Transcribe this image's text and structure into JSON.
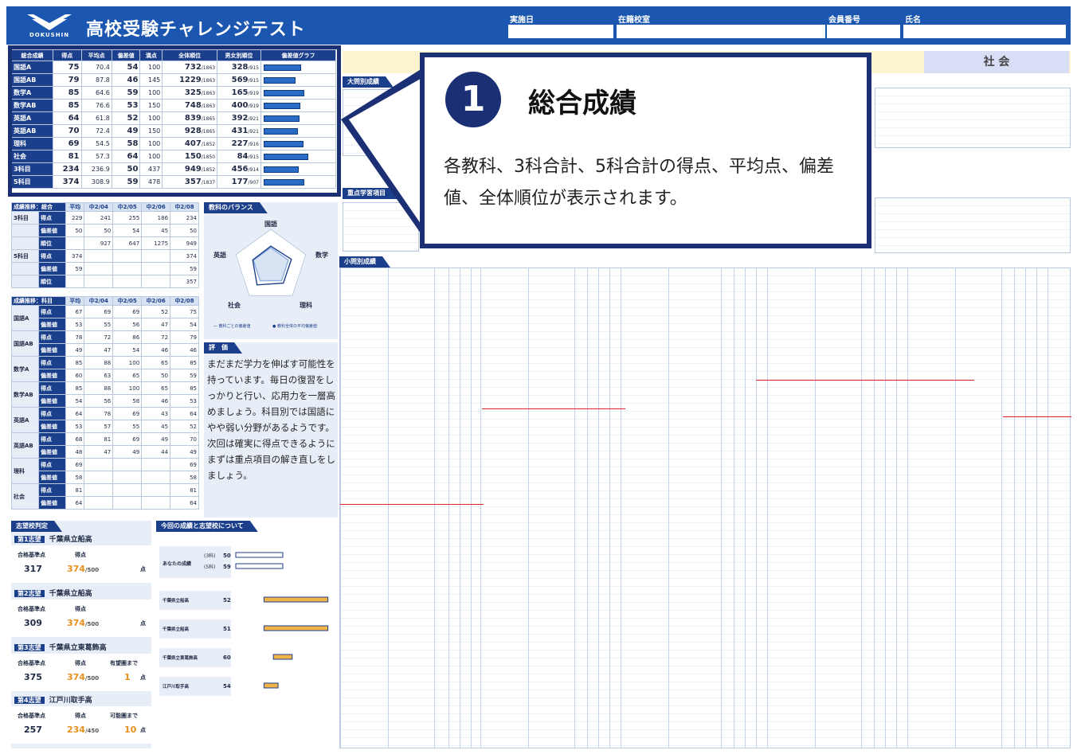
{
  "header": {
    "logo_text": "DOKUSHIN",
    "title": "高校受験チャレンジテスト",
    "fields": [
      "実施日",
      "在籍校室",
      "会員番号",
      "氏名"
    ]
  },
  "summary": {
    "columns": [
      "総合成績",
      "得点",
      "平均点",
      "偏差値",
      "満点",
      "全体順位",
      "男女別順位",
      "偏差値グラフ"
    ],
    "rows": [
      {
        "name": "国語A",
        "score": "75",
        "avg": "70.4",
        "dev": "54",
        "full": "100",
        "rank": "732",
        "rank_total": "/1863",
        "grank": "328",
        "grank_total": "/915",
        "level": 0.54
      },
      {
        "name": "国語AB",
        "score": "79",
        "avg": "87.8",
        "dev": "46",
        "full": "145",
        "rank": "1229",
        "rank_total": "/1863",
        "grank": "569",
        "grank_total": "/915",
        "level": 0.46
      },
      {
        "name": "数学A",
        "score": "85",
        "avg": "64.6",
        "dev": "59",
        "full": "100",
        "rank": "325",
        "rank_total": "/1863",
        "grank": "165",
        "grank_total": "/919",
        "level": 0.59
      },
      {
        "name": "数学AB",
        "score": "85",
        "avg": "76.6",
        "dev": "53",
        "full": "150",
        "rank": "748",
        "rank_total": "/1863",
        "grank": "400",
        "grank_total": "/919",
        "level": 0.53
      },
      {
        "name": "英語A",
        "score": "64",
        "avg": "61.8",
        "dev": "52",
        "full": "100",
        "rank": "839",
        "rank_total": "/1865",
        "grank": "392",
        "grank_total": "/921",
        "level": 0.52
      },
      {
        "name": "英語AB",
        "score": "70",
        "avg": "72.4",
        "dev": "49",
        "full": "150",
        "rank": "928",
        "rank_total": "/1865",
        "grank": "431",
        "grank_total": "/921",
        "level": 0.49
      },
      {
        "name": "理科",
        "score": "69",
        "avg": "54.5",
        "dev": "58",
        "full": "100",
        "rank": "407",
        "rank_total": "/1852",
        "grank": "227",
        "grank_total": "/916",
        "level": 0.58
      },
      {
        "name": "社会",
        "score": "81",
        "avg": "57.3",
        "dev": "64",
        "full": "100",
        "rank": "150",
        "rank_total": "/1850",
        "grank": "84",
        "grank_total": "/915",
        "level": 0.64
      },
      {
        "name": "3科目",
        "score": "234",
        "avg": "236.9",
        "dev": "50",
        "full": "437",
        "rank": "949",
        "rank_total": "/1852",
        "grank": "456",
        "grank_total": "/914",
        "level": 0.5
      },
      {
        "name": "5科目",
        "score": "374",
        "avg": "308.9",
        "dev": "59",
        "full": "478",
        "rank": "357",
        "rank_total": "/1837",
        "grank": "177",
        "grank_total": "/907",
        "level": 0.59
      }
    ]
  },
  "callout": {
    "number": "1",
    "title": "総合成績",
    "body": "各教科、3科合計、5科合計の得点、平均点、偏差値、全体順位が表示されます。"
  },
  "right_top": {
    "subject_social": "社 会"
  },
  "trend_total": {
    "head": "成績推移：総合",
    "cols": [
      "平均",
      "中2/04",
      "中2/05",
      "中2/06",
      "中2/08"
    ],
    "rows": [
      {
        "g": "3科目",
        "k": "得点",
        "v": [
          "229",
          "241",
          "255",
          "186",
          "234"
        ]
      },
      {
        "g": "",
        "k": "偏差値",
        "v": [
          "50",
          "50",
          "54",
          "45",
          "50"
        ]
      },
      {
        "g": "",
        "k": "順位",
        "v": [
          "",
          "927",
          "647",
          "1275",
          "949"
        ]
      },
      {
        "g": "5科目",
        "k": "得点",
        "v": [
          "374",
          "",
          "",
          "",
          "374"
        ]
      },
      {
        "g": "",
        "k": "偏差値",
        "v": [
          "59",
          "",
          "",
          "",
          "59"
        ]
      },
      {
        "g": "",
        "k": "順位",
        "v": [
          "",
          "",
          "",
          "",
          "357"
        ]
      }
    ]
  },
  "trend_subject": {
    "head": "成績推移：科目",
    "cols": [
      "平均",
      "中2/04",
      "中2/05",
      "中2/06",
      "中2/08"
    ],
    "rows": [
      {
        "g": "国語A",
        "v1": [
          "67",
          "69",
          "69",
          "52",
          "75"
        ],
        "v2": [
          "53",
          "55",
          "56",
          "47",
          "54"
        ]
      },
      {
        "g": "国語AB",
        "v1": [
          "78",
          "72",
          "86",
          "72",
          "79"
        ],
        "v2": [
          "49",
          "47",
          "54",
          "46",
          "46"
        ]
      },
      {
        "g": "数学A",
        "v1": [
          "85",
          "88",
          "100",
          "65",
          "85"
        ],
        "v2": [
          "60",
          "63",
          "65",
          "50",
          "59"
        ]
      },
      {
        "g": "数学AB",
        "v1": [
          "85",
          "88",
          "100",
          "65",
          "85"
        ],
        "v2": [
          "54",
          "56",
          "58",
          "46",
          "53"
        ]
      },
      {
        "g": "英語A",
        "v1": [
          "64",
          "78",
          "69",
          "43",
          "64"
        ],
        "v2": [
          "53",
          "57",
          "55",
          "45",
          "52"
        ]
      },
      {
        "g": "英語AB",
        "v1": [
          "68",
          "81",
          "69",
          "49",
          "70"
        ],
        "v2": [
          "48",
          "47",
          "49",
          "44",
          "49"
        ]
      },
      {
        "g": "理科",
        "v1": [
          "69",
          "",
          "",
          "",
          "69"
        ],
        "v2": [
          "58",
          "",
          "",
          "",
          "58"
        ]
      },
      {
        "g": "社会",
        "v1": [
          "81",
          "",
          "",
          "",
          "81"
        ],
        "v2": [
          "64",
          "",
          "",
          "",
          "64"
        ]
      }
    ],
    "kinds": [
      "得点",
      "偏差値"
    ]
  },
  "balance": {
    "head": "教科のバランス",
    "labels": [
      "国語",
      "数学",
      "理科",
      "社会",
      "英語"
    ],
    "student": [
      0.54,
      0.59,
      0.58,
      0.64,
      0.52
    ],
    "average": [
      0.5,
      0.5,
      0.5,
      0.5,
      0.5
    ],
    "legend_student": "教科ごとの偏差値",
    "legend_avg": "教科全体の平均偏差値"
  },
  "evaluation": {
    "head": "評　価",
    "text": "まだまだ学力を伸ばす可能性を持っています。毎日の復習をしっかりと行い、応用力を一層高めましょう。科目別では国語にやや弱い分野があるようです。次回は確実に得点できるようにまずは重点項目の解き直しをしましょう。"
  },
  "schools": {
    "head": "志望校判定",
    "items": [
      {
        "rank": "第1志望",
        "name": "千葉県立船高",
        "l1": "合格基準点",
        "l2": "得点",
        "l3": "",
        "base": "317",
        "score": "374",
        "max": "/500",
        "note": ""
      },
      {
        "rank": "第2志望",
        "name": "千葉県立船高",
        "l1": "合格基準点",
        "l2": "得点",
        "l3": "",
        "base": "309",
        "score": "374",
        "max": "/500",
        "note": ""
      },
      {
        "rank": "第3志望",
        "name": "千葉県立東葛飾高",
        "l1": "合格基準点",
        "l2": "得点",
        "l3": "有望圏まで",
        "base": "375",
        "score": "374",
        "max": "/500",
        "note": "1"
      },
      {
        "rank": "第4志望",
        "name": "江戸川取手高",
        "l1": "合格基準点",
        "l2": "得点",
        "l3": "可能圏まで",
        "base": "257",
        "score": "234",
        "max": "/450",
        "note": "10"
      }
    ],
    "unit": "点"
  },
  "school_chart": {
    "head": "今回の成績と志望校について",
    "you_label": "あなたの成績",
    "you_rows": [
      {
        "k": "(3科)",
        "v": "50"
      },
      {
        "k": "(5科)",
        "v": "59"
      }
    ],
    "schools": [
      {
        "name": "千葉県立船高",
        "v": "52",
        "from": 0.3,
        "to": 0.98
      },
      {
        "name": "千葉県立船高",
        "v": "51",
        "from": 0.3,
        "to": 0.98
      },
      {
        "name": "千葉県立東葛飾高",
        "v": "60",
        "from": 0.4,
        "to": 0.6
      },
      {
        "name": "江戸川取手高",
        "v": "54",
        "from": 0.3,
        "to": 0.45
      }
    ]
  },
  "sections": {
    "big_unit": "大問別成績",
    "focus": "重点学習項目",
    "small_unit": "小問別成績"
  }
}
